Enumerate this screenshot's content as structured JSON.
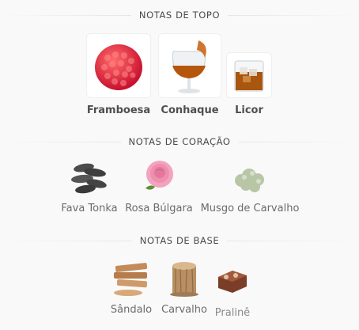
{
  "sections": [
    {
      "title": "NOTAS DE TOPO",
      "notes": [
        {
          "label": "Framboesa",
          "icon": "raspberry-icon"
        },
        {
          "label": "Conhaque",
          "icon": "cognac-glass-icon"
        },
        {
          "label": "Licor",
          "icon": "liquor-glass-icon"
        }
      ]
    },
    {
      "title": "NOTAS DE CORAÇÃO",
      "notes": [
        {
          "label": "Fava Tonka",
          "icon": "tonka-bean-icon"
        },
        {
          "label": "Rosa Búlgara",
          "icon": "rose-icon"
        },
        {
          "label": "Musgo de Carvalho",
          "icon": "oakmoss-icon"
        }
      ]
    },
    {
      "title": "NOTAS DE BASE",
      "notes": [
        {
          "label": "Sândalo",
          "icon": "sandalwood-icon"
        },
        {
          "label": "Carvalho",
          "icon": "oak-wood-icon"
        },
        {
          "label": "Pralinê",
          "icon": "praline-icon"
        }
      ]
    }
  ]
}
